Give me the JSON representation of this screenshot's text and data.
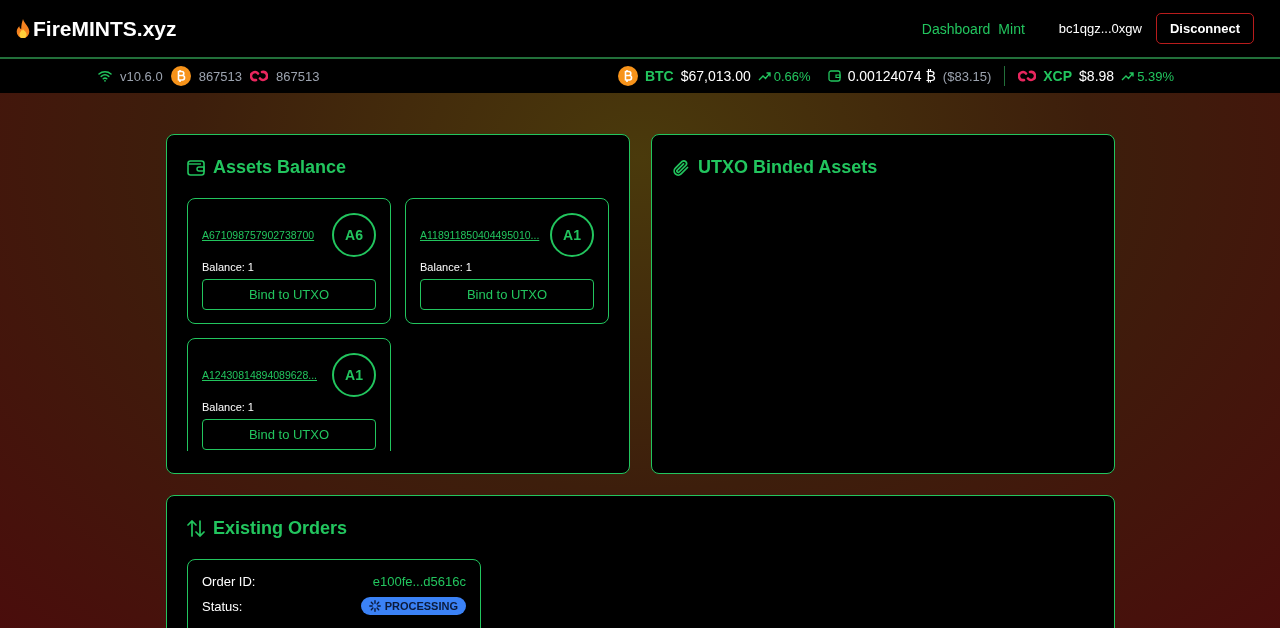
{
  "header": {
    "logo": "FireMINTS.xyz",
    "nav": [
      {
        "label": "Dashboard"
      },
      {
        "label": "Mint"
      }
    ],
    "address": "bc1qgz...0xgw",
    "disconnect": "Disconnect"
  },
  "ticker": {
    "version": "v10.6.0",
    "btc_block": "867513",
    "xcp_block": "867513",
    "btc": {
      "symbol": "BTC",
      "price": "$67,013.00",
      "change": "0.66%"
    },
    "wallet": {
      "amount": "0.00124074 ₿",
      "usd": "($83.15)"
    },
    "xcp": {
      "symbol": "XCP",
      "price": "$8.98",
      "change": "5.39%"
    }
  },
  "assets_panel": {
    "title": "Assets Balance",
    "assets": [
      {
        "name": "A671098757902738700",
        "badge": "A6",
        "balance": "Balance: 1",
        "action": "Bind to UTXO"
      },
      {
        "name": "A118911850404495010...",
        "badge": "A1",
        "balance": "Balance: 1",
        "action": "Bind to UTXO"
      },
      {
        "name": "A12430814894089628...",
        "badge": "A1",
        "balance": "Balance: 1",
        "action": "Bind to UTXO"
      }
    ]
  },
  "utxo_panel": {
    "title": "UTXO Binded Assets"
  },
  "orders_panel": {
    "title": "Existing Orders",
    "orders": [
      {
        "rows": [
          {
            "kind": "text",
            "label": "Order ID:",
            "value": "e100fe...d5616c"
          },
          {
            "kind": "status",
            "label": "Status:",
            "value": "PROCESSING"
          }
        ]
      }
    ]
  }
}
